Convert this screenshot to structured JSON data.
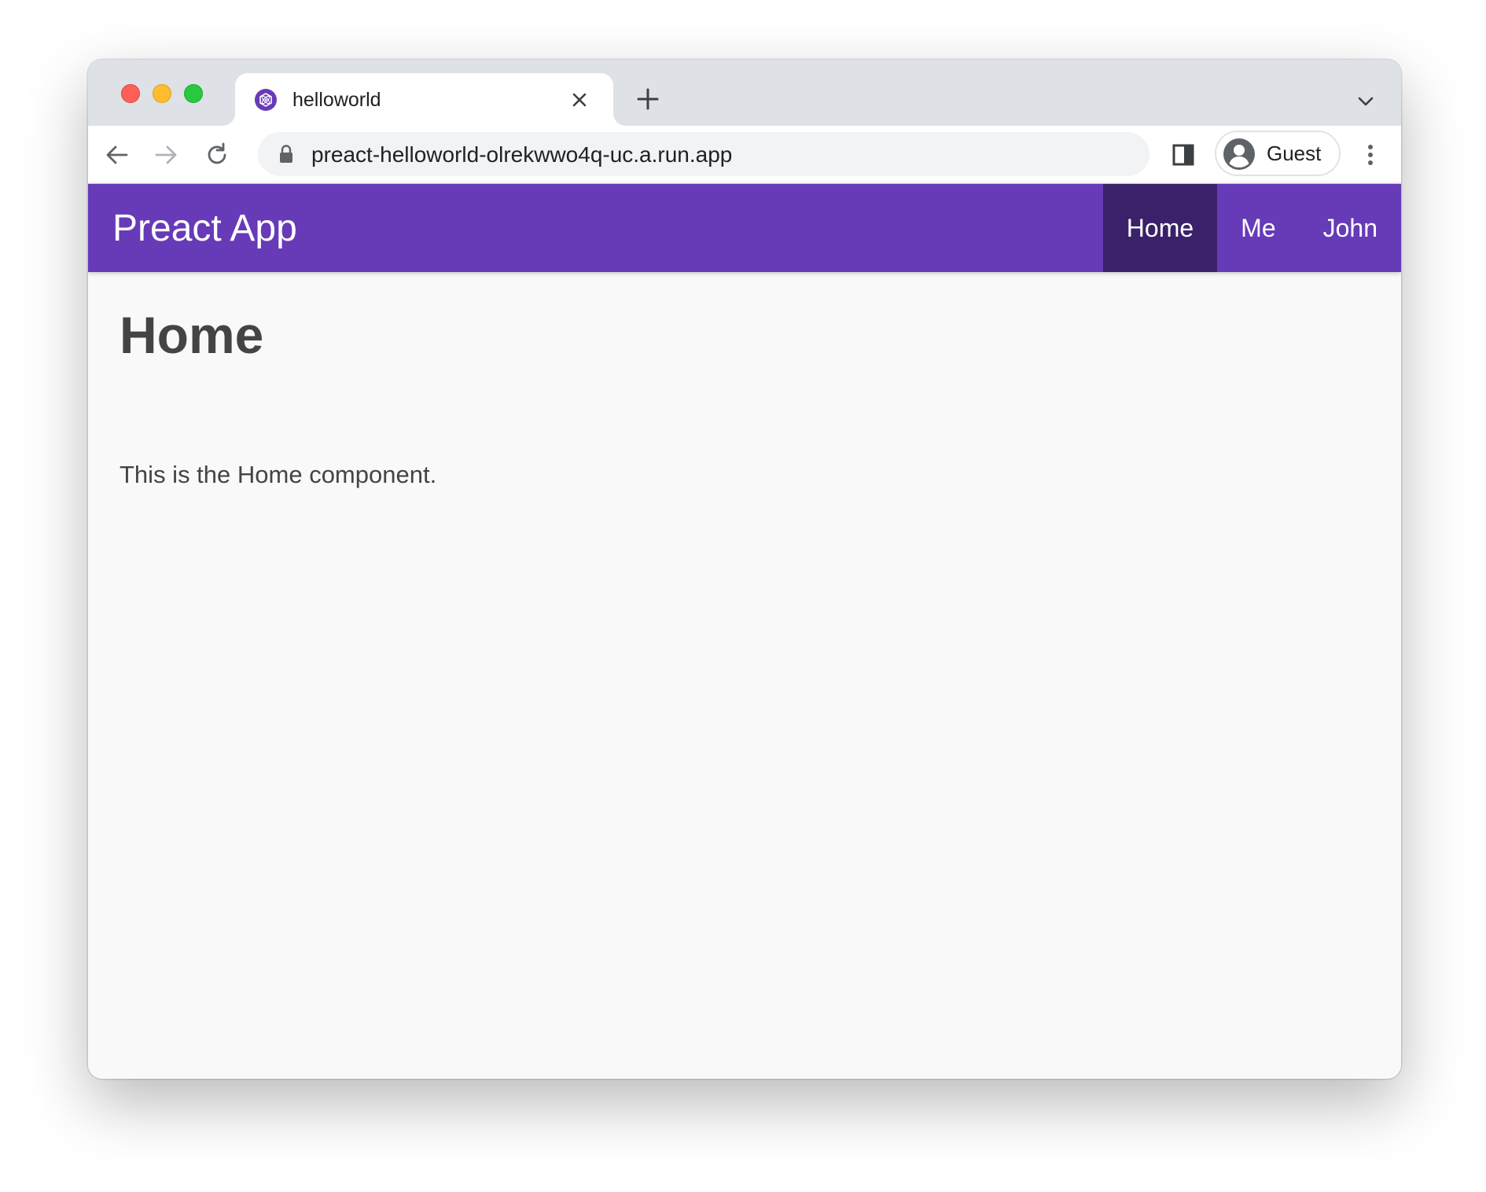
{
  "browser": {
    "tab": {
      "title": "helloworld",
      "favicon": "preact-logo-icon"
    },
    "address_bar": {
      "url": "preact-helloworld-olrekwwo4q-uc.a.run.app"
    },
    "profile": {
      "name": "Guest"
    },
    "colors": {
      "tabstrip": "#dee1e6",
      "traffic_close": "#fe5f57",
      "traffic_minimize": "#febc2e",
      "traffic_maximize": "#28c840"
    }
  },
  "app": {
    "title": "Preact App",
    "nav": [
      {
        "label": "Home",
        "active": true
      },
      {
        "label": "Me",
        "active": false
      },
      {
        "label": "John",
        "active": false
      }
    ],
    "colors": {
      "header": "#673ab8",
      "nav_active": "#3b2169",
      "text": "#444444",
      "background": "#f9f9f9"
    }
  },
  "main": {
    "heading": "Home",
    "text": "This is the Home component."
  }
}
